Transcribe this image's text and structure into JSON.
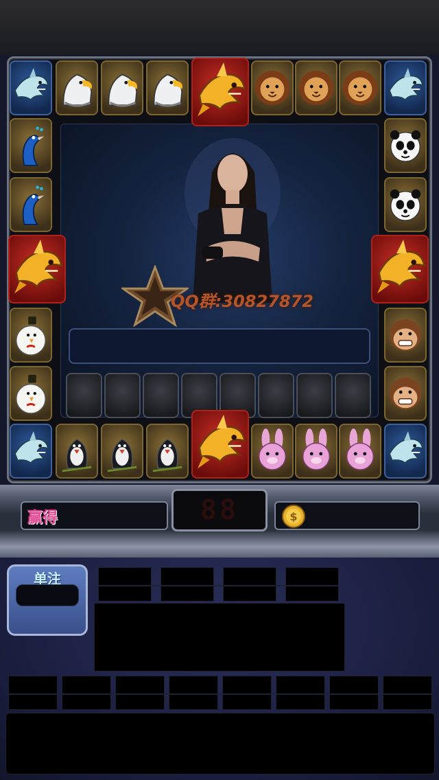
{
  "board": {
    "watermark": "QQ群:30827872",
    "ring": [
      {
        "pos": "top-0",
        "animal": "shark",
        "frame": "blue"
      },
      {
        "pos": "top-1",
        "animal": "eagle",
        "frame": "gold"
      },
      {
        "pos": "top-2",
        "animal": "eagle",
        "frame": "gold"
      },
      {
        "pos": "top-3",
        "animal": "eagle",
        "frame": "gold"
      },
      {
        "pos": "top-4",
        "animal": "golden-shark",
        "frame": "red"
      },
      {
        "pos": "top-5",
        "animal": "lion",
        "frame": "gold"
      },
      {
        "pos": "top-6",
        "animal": "lion",
        "frame": "gold"
      },
      {
        "pos": "top-7",
        "animal": "lion",
        "frame": "gold"
      },
      {
        "pos": "top-8",
        "animal": "shark",
        "frame": "blue"
      },
      {
        "pos": "left-1",
        "animal": "peacock",
        "frame": "gold"
      },
      {
        "pos": "left-2",
        "animal": "peacock",
        "frame": "gold"
      },
      {
        "pos": "left-3",
        "animal": "golden-shark",
        "frame": "red"
      },
      {
        "pos": "left-4",
        "animal": "chicken",
        "frame": "gold"
      },
      {
        "pos": "left-5",
        "animal": "chicken",
        "frame": "gold"
      },
      {
        "pos": "right-1",
        "animal": "panda",
        "frame": "gold"
      },
      {
        "pos": "right-2",
        "animal": "panda",
        "frame": "gold"
      },
      {
        "pos": "right-3",
        "animal": "golden-shark",
        "frame": "red"
      },
      {
        "pos": "right-4",
        "animal": "monkey",
        "frame": "gold"
      },
      {
        "pos": "right-5",
        "animal": "monkey",
        "frame": "gold"
      },
      {
        "pos": "bottom-0",
        "animal": "shark",
        "frame": "blue"
      },
      {
        "pos": "bottom-1",
        "animal": "swallow",
        "frame": "gold"
      },
      {
        "pos": "bottom-2",
        "animal": "swallow",
        "frame": "gold"
      },
      {
        "pos": "bottom-3",
        "animal": "swallow",
        "frame": "gold"
      },
      {
        "pos": "bottom-4",
        "animal": "golden-shark",
        "frame": "red"
      },
      {
        "pos": "bottom-5",
        "animal": "rabbit",
        "frame": "gold"
      },
      {
        "pos": "bottom-6",
        "animal": "rabbit",
        "frame": "gold"
      },
      {
        "pos": "bottom-7",
        "animal": "rabbit",
        "frame": "gold"
      },
      {
        "pos": "bottom-8",
        "animal": "shark",
        "frame": "blue"
      }
    ],
    "history_slots": 8
  },
  "controls": {
    "win_label": "赢得",
    "led_value": "88",
    "coin_icon": "gold-coin-icon",
    "single_bet_label": "单注"
  },
  "colors": {
    "win_label": "#e04f95",
    "watermark": "#b3542a",
    "single_bet_label": "#c9f4ff"
  }
}
